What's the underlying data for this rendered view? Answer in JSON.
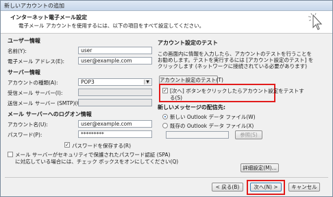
{
  "window": {
    "title": "新しいアカウントの追加"
  },
  "header": {
    "title": "インターネット電子メール設定",
    "subtitle": "電子メール アカウントを使用するには、以下の項目をすべて設定してください。"
  },
  "user_info": {
    "section": "ユーザー情報",
    "name_label": "名前(Y):",
    "name_value": "user",
    "email_label": "電子メール アドレス(E):",
    "email_value": "user@example.com"
  },
  "server_info": {
    "section": "サーバー情報",
    "account_type_label": "アカウントの種類(A):",
    "account_type_value": "POP3",
    "incoming_label": "受信メール サーバー(I):",
    "outgoing_label": "送信メール サーバー (SMTP)(O):"
  },
  "logon_info": {
    "section": "メール サーバーへのログオン情報",
    "account_name_label": "アカウント名(U):",
    "account_name_value": "user@example.com",
    "password_label": "パスワード(P):",
    "password_value": "*********",
    "save_password_label": "パスワードを保存する(R)",
    "spa_label_line1": "メール サーバーがセキュリティで保護されたパスワード認証 (SPA)",
    "spa_label_line2": "に対応している場合には、チェック ボックスをオンにしてください(Q)"
  },
  "test": {
    "section": "アカウント設定のテスト",
    "desc1": "この画面内に情報を入力したら、アカウントのテストを行うことを",
    "desc2": "お勧めします。テストを実行するには [アカウント設定のテスト] を",
    "desc3": "クリックします (ネットワークに接続されている必要があります)",
    "test_button": "アカウント設定のテスト(T)",
    "auto_test_line1": "[次へ] ボタンをクリックしたらアカウント設定をテストす",
    "auto_test_line2": "る(S)"
  },
  "delivery": {
    "section": "新しいメッセージの配信先:",
    "new_pst": "新しい Outlook データ ファイル(W)",
    "existing_pst": "既存の Outlook データ ファイル(X)",
    "browse": "参照(S)"
  },
  "more_settings": "詳細設定(M)...",
  "footer": {
    "back": "< 戻る(B)",
    "next": "次へ(N) >",
    "cancel": "キャンセル"
  }
}
